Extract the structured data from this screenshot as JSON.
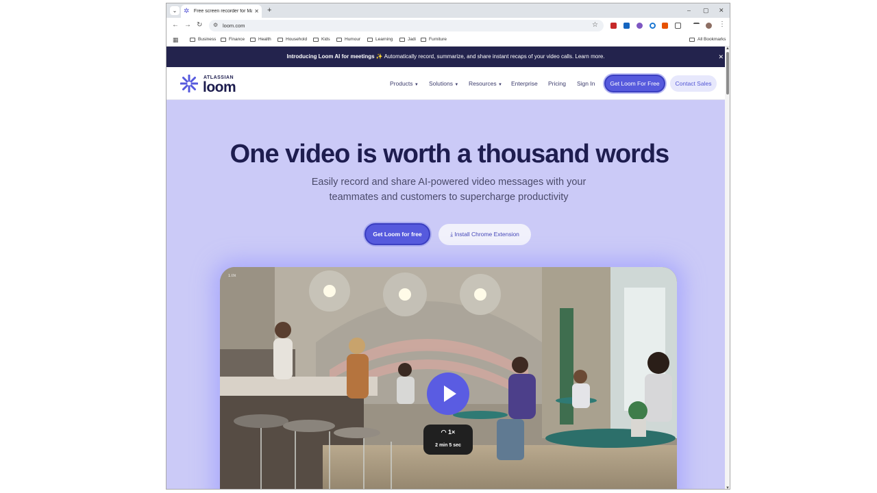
{
  "browser": {
    "tab_title": "Free screen recorder for Mac an",
    "url": "loom.com",
    "bookmarks": [
      "Business",
      "Finance",
      "Health",
      "Household",
      "Kids",
      "Humour",
      "Learning",
      "Jadi",
      "Furniture"
    ],
    "all_bookmarks_label": "All Bookmarks"
  },
  "banner": {
    "bold": "Introducing Loom AI for meetings",
    "sparkle": "✨",
    "text": "Automatically record, summarize, and share instant recaps of your video calls. Learn more."
  },
  "nav": {
    "logo_small": "ATLASSIAN",
    "logo_big": "loom",
    "products": "Products",
    "solutions": "Solutions",
    "resources": "Resources",
    "enterprise": "Enterprise",
    "pricing": "Pricing",
    "sign_in": "Sign In",
    "get_loom": "Get Loom For Free",
    "contact_sales": "Contact Sales"
  },
  "hero": {
    "title": "One video is worth a thousand words",
    "subtitle": "Easily record and share AI-powered video messages with your teammates and customers to supercharge productivity",
    "cta_primary": "Get Loom for free",
    "cta_secondary": "Install Chrome Extension"
  },
  "video": {
    "corner_badge": "1.0x",
    "speed": "1×",
    "duration": "2 min 5 sec"
  },
  "colors": {
    "accent": "#565add",
    "hero_bg": "#cbcaf7",
    "banner_bg": "#23234d",
    "text_dark": "#1e1d4f"
  }
}
